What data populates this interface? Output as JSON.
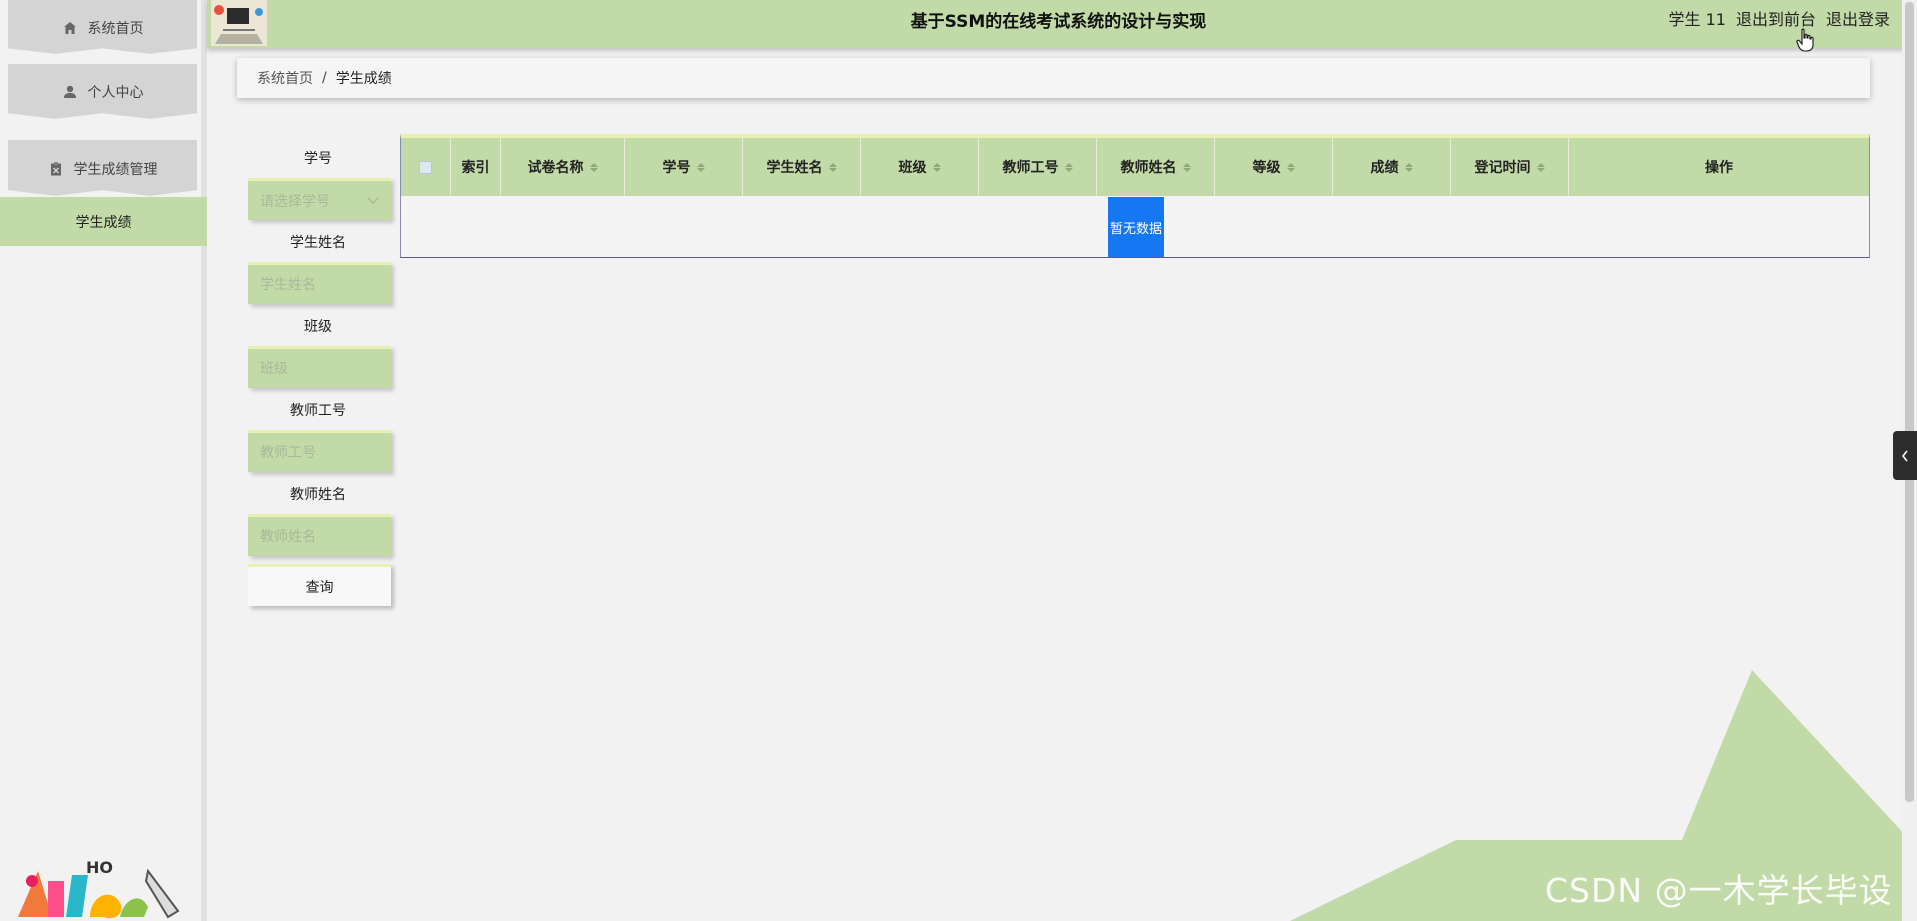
{
  "app": {
    "title": "基于SSM的在线考试系统的设计与实现"
  },
  "topbar": {
    "username": "学生 11",
    "to_frontend": "退出到前台",
    "logout": "退出登录"
  },
  "sidebar": {
    "items": [
      {
        "label": "系统首页",
        "icon": "home-icon"
      },
      {
        "label": "个人中心",
        "icon": "user-icon"
      },
      {
        "label": "学生成绩管理",
        "icon": "clipboard-icon"
      }
    ],
    "sub_items": [
      {
        "label": "学生成绩",
        "active": true
      }
    ]
  },
  "breadcrumb": {
    "home": "系统首页",
    "separator": "/",
    "current": "学生成绩"
  },
  "search": {
    "student_no_label": "学号",
    "student_no_placeholder": "请选择学号",
    "student_name_label": "学生姓名",
    "student_name_placeholder": "学生姓名",
    "class_label": "班级",
    "class_placeholder": "班级",
    "teacher_no_label": "教师工号",
    "teacher_no_placeholder": "教师工号",
    "teacher_name_label": "教师姓名",
    "teacher_name_placeholder": "教师姓名",
    "submit_label": "查询"
  },
  "table": {
    "columns": [
      "索引",
      "试卷名称",
      "学号",
      "学生姓名",
      "班级",
      "教师工号",
      "教师姓名",
      "等级",
      "成绩",
      "登记时间",
      "操作"
    ],
    "empty_text": "暂无数据",
    "rows": []
  },
  "watermark": "CSDN @一木学长毕设",
  "colors": {
    "accent": "#c2daa7",
    "empty_badge": "#1677f2",
    "background": "#f2f2f2"
  }
}
